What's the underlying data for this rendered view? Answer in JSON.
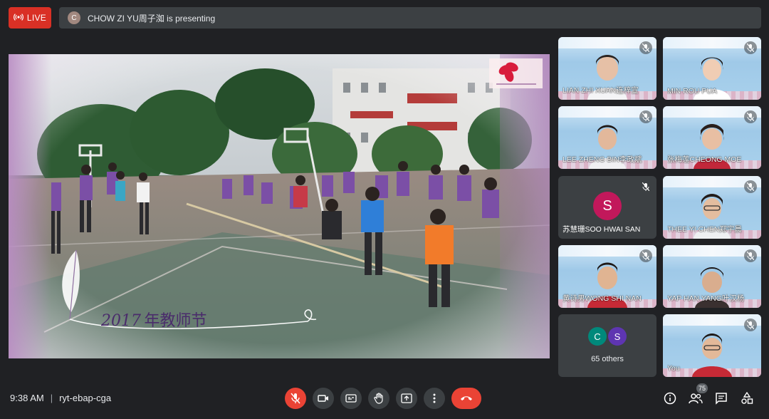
{
  "top": {
    "live_label": "LIVE",
    "presenter_initial": "C",
    "presenting_text": "CHOW ZI YU周子洳 is presenting"
  },
  "presentation": {
    "caption_year": "2017",
    "caption_text": "年教师节"
  },
  "participants": [
    {
      "name": "LIAN ZHI XUAN连梓宣",
      "muted": true
    },
    {
      "name": "MIN ROU PUA",
      "muted": true
    },
    {
      "name": "LEE ZHENG BIN李政斌",
      "muted": true
    },
    {
      "name": "张梅莲CHEONG MOE",
      "muted": true
    },
    {
      "name": "苏慧珊SOO HWAI SAN",
      "initial": "S",
      "muted": true
    },
    {
      "name": "THEE YI CHEN郑宇晨",
      "muted": true
    },
    {
      "name": "黄诗男WONG SHI NAN",
      "muted": true
    },
    {
      "name": "YAP HAN YANG叶汉杨",
      "muted": true
    },
    {
      "others_initials": [
        "C",
        "S"
      ],
      "label": "65 others"
    },
    {
      "name": "You",
      "muted": true
    }
  ],
  "bottom": {
    "time": "9:38 AM",
    "separator": "|",
    "meeting_code": "ryt-ebap-cga",
    "participant_count": "75"
  },
  "colors": {
    "live": "#d93025",
    "end_call": "#ea4335",
    "background": "#202124",
    "tile": "#3c4043"
  }
}
